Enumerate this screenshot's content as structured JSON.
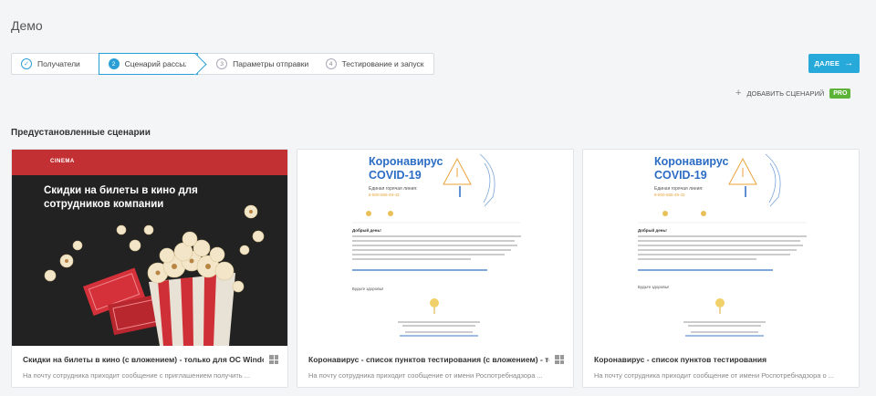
{
  "page": {
    "title": "Демо"
  },
  "steps": [
    {
      "number": "1",
      "label": "Получатели",
      "state": "done"
    },
    {
      "number": "2",
      "label": "Сценарий рассылки",
      "state": "active"
    },
    {
      "number": "3",
      "label": "Параметры отправки",
      "state": "pending"
    },
    {
      "number": "4",
      "label": "Тестирование и запуск",
      "state": "pending"
    }
  ],
  "toolbar": {
    "next_label": "ДАЛЕЕ",
    "add_scenario_label": "ДОБАВИТЬ СЦЕНАРИЙ",
    "pro_badge": "PRO"
  },
  "section": {
    "title": "Предустановленные сценарии"
  },
  "colors": {
    "accent": "#27a9d9",
    "pro": "#5cb338",
    "cinema_red": "#c33033",
    "covid_blue": "#2b6cc4"
  },
  "cards": [
    {
      "title": "Скидки на билеты в кино (с вложением) - только для ОС Windows",
      "description": "На почту сотрудника приходит сообщение с приглашением получить ...",
      "has_windows_icon": true,
      "thumb": {
        "brand": "CINEMA",
        "headline": "Скидки на билеты в кино для сотрудников компании"
      }
    },
    {
      "title": "Коронавирус - список пунктов тестирования (с вложением) - только для ОС Windows",
      "description": "На почту сотрудника приходит сообщение от имени Роспотребнадзора ...",
      "has_windows_icon": true,
      "thumb": {
        "headline_line1": "Коронавирус",
        "headline_line2": "COVID-19",
        "sub": "Единая горячая линия:",
        "phone": "8-800-555-49-43",
        "hello": "Добрый день!",
        "regards": "Будьте здоровы!"
      }
    },
    {
      "title": "Коронавирус - список пунктов тестирования",
      "description": "На почту сотрудника приходит сообщение от имени Роспотребнадзора о ...",
      "has_windows_icon": false,
      "thumb": {
        "headline_line1": "Коронавирус",
        "headline_line2": "COVID-19",
        "sub": "Единая горячая линия:",
        "phone": "8-800-555-49-43",
        "hello": "Добрый день!",
        "regards": "Будьте здоровы!"
      }
    }
  ]
}
